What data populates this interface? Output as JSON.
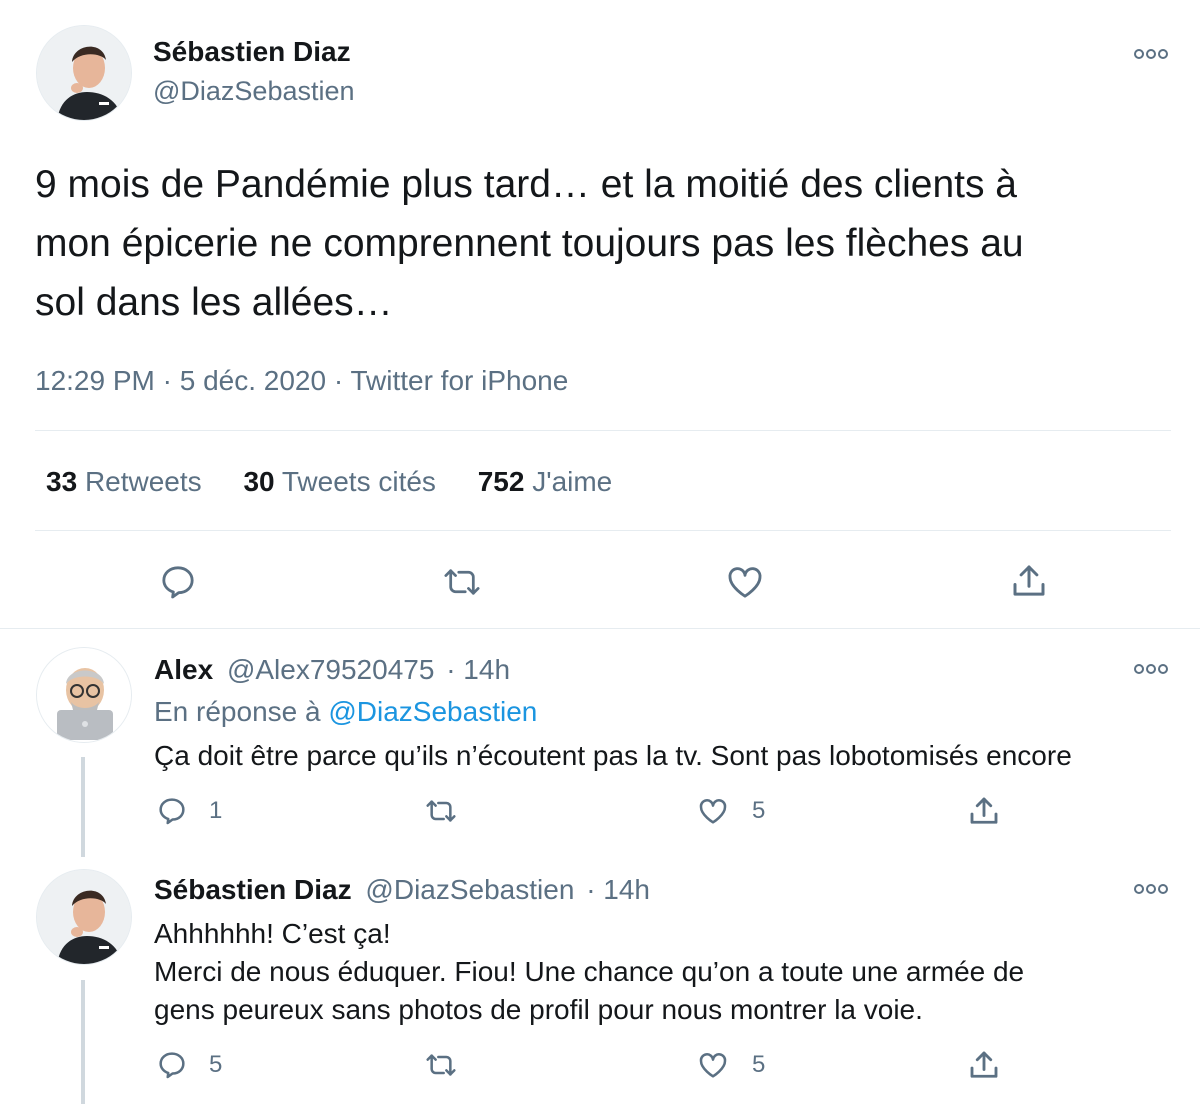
{
  "main_tweet": {
    "author_name": "Sébastien Diaz",
    "author_handle": "@DiazSebastien",
    "text_lines": [
      "9 mois de Pandémie plus tard… et la moitié des clients à",
      "mon épicerie ne comprennent toujours pas les flèches au",
      "sol dans les allées…"
    ],
    "timestamp": "12:29 PM · 5 déc. 2020 · Twitter for iPhone",
    "stats": {
      "retweets_count": "33",
      "retweets_label": "Retweets",
      "quotes_count": "30",
      "quotes_label": "Tweets cités",
      "likes_count": "752",
      "likes_label": "J'aime"
    }
  },
  "replies": [
    {
      "author_name": "Alex",
      "author_handle": "@Alex79520475",
      "time": "· 14h",
      "reply_to_prefix": "En réponse à",
      "reply_to_handle": "@DiazSebastien",
      "text_lines": [
        "Ça doit être parce qu’ils n’écoutent pas la tv. Sont pas lobotomisés encore"
      ],
      "reply_count": "1",
      "like_count": "5"
    },
    {
      "author_name": "Sébastien Diaz",
      "author_handle": "@DiazSebastien",
      "time": "· 14h",
      "text_lines": [
        "Ahhhhhh! C’est ça!",
        "Merci de nous éduquer. Fiou! Une chance qu’on a toute une armée de",
        "gens peureux sans photos de profil pour nous montrer la voie."
      ],
      "reply_count": "5",
      "like_count": "5"
    }
  ],
  "colors": {
    "text": "#14171a",
    "secondary": "#5b7083",
    "link": "#1b95e0",
    "divider": "#e6ecf0",
    "thread_line": "#d0d8de"
  }
}
